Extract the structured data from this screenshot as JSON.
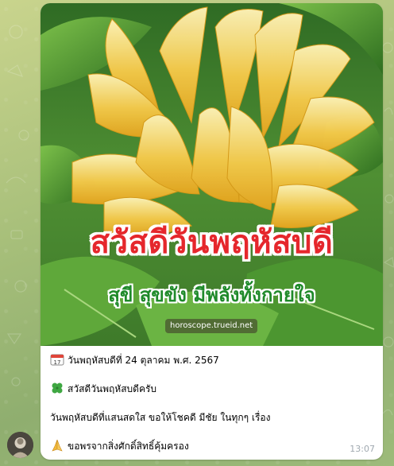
{
  "message": {
    "image": {
      "headline": "สวัสดีวันพฤหัสบดี",
      "subline": "สุขี สุขขัง มีพลังทั้งกายใจ",
      "watermark": "horoscope.trueid.net"
    },
    "lines": [
      {
        "icon": "calendar-icon",
        "text": "วันพฤหัสบดีที่ 24 ตุลาคม พ.ศ. 2567"
      },
      {
        "icon": "four-leaf-clover-icon",
        "text": "สวัสดีวันพฤหัสบดีครับ"
      },
      {
        "icon": "",
        "text": "วันพฤหัสบดีที่แสนสดใส ขอให้โชคดี มีชัย ในทุกๆ เรื่อง"
      },
      {
        "icon": "praying-hands-icon",
        "text": "ขอพรจากสิ่งศักดิ์สิทธิ์คุ้มครอง"
      }
    ],
    "time": "13:07"
  },
  "sender": {
    "avatar_icon": "user-avatar"
  },
  "colors": {
    "headline": "#e5272c",
    "subline": "#1f8a2a",
    "time": "#a0a9b0"
  }
}
